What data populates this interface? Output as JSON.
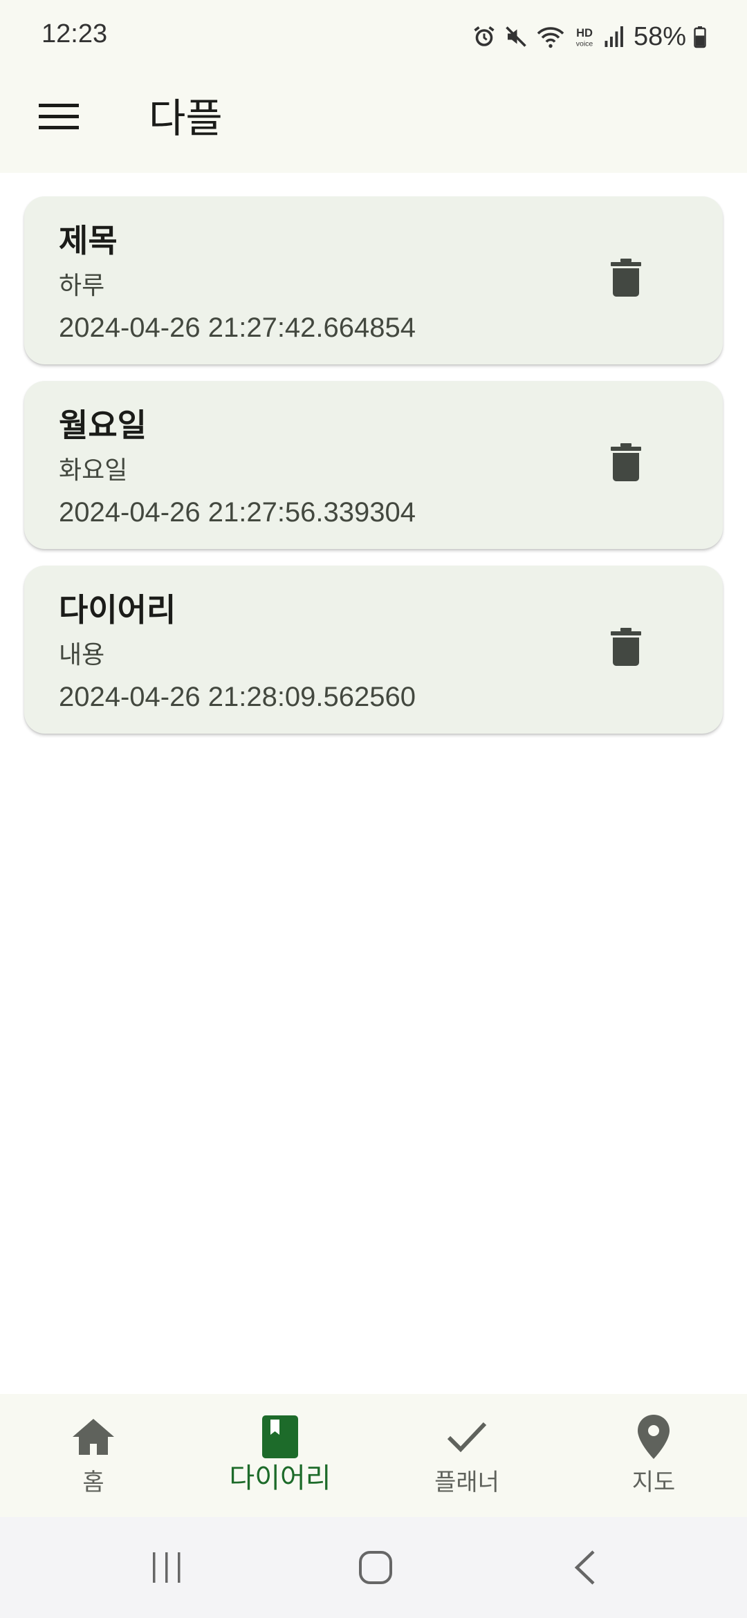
{
  "status_bar": {
    "time": "12:23",
    "battery": "58%",
    "icons": [
      "alarm-icon",
      "mute-icon",
      "wifi-icon",
      "hd-voice-icon",
      "signal-icon",
      "battery-icon"
    ]
  },
  "app_bar": {
    "title": "다플",
    "menu_icon": "menu-icon"
  },
  "entries": [
    {
      "title": "제목",
      "content": "하루",
      "date": "2024-04-26 21:27:42.664854"
    },
    {
      "title": "월요일",
      "content": "화요일",
      "date": "2024-04-26 21:27:56.339304"
    },
    {
      "title": "다이어리",
      "content": "내용",
      "date": "2024-04-26 21:28:09.562560"
    }
  ],
  "bottom_nav": {
    "items": [
      {
        "label": "홈",
        "icon": "home-icon"
      },
      {
        "label": "다이어리",
        "icon": "diary-bookmark-icon",
        "active": true
      },
      {
        "label": "플래너",
        "icon": "check-icon"
      },
      {
        "label": "지도",
        "icon": "map-pin-icon"
      }
    ]
  },
  "colors": {
    "surface": "#f8f9f2",
    "card": "#eef2ea",
    "accent": "#1d6b2a",
    "icon": "#434842"
  }
}
